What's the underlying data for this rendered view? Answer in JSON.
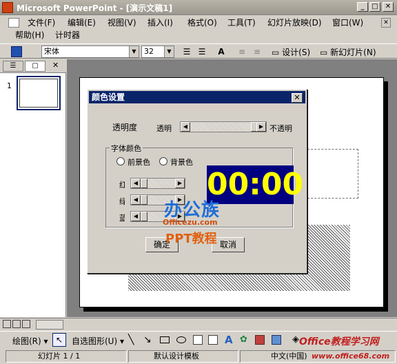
{
  "window": {
    "title": "Microsoft PowerPoint - [演示文稿1]"
  },
  "menu": {
    "items": [
      "文件(F)",
      "编辑(E)",
      "视图(V)",
      "插入(I)",
      "格式(O)",
      "工具(T)",
      "幻灯片放映(D)",
      "窗口(W)"
    ],
    "items_row2": [
      "帮助(H)",
      "计时器"
    ]
  },
  "toolbar": {
    "font": "宋体",
    "size": "32",
    "design_label": "设计(S)",
    "new_slide_label": "新幻灯片(N)"
  },
  "slides_pane": {
    "slide_number": "1"
  },
  "dialog": {
    "title": "颜色设置",
    "transparency_label": "透明度",
    "transparent": "透明",
    "opaque": "不透明",
    "font_color_group": "字体颜色",
    "foreground": "前景色",
    "background": "背景色",
    "red_label": "红",
    "green_label": "绿",
    "blue_label": "蓝",
    "clock": "00:00",
    "ok": "确定",
    "cancel": "取消"
  },
  "watermark": {
    "brand": "办公族",
    "site": "Officezu.com",
    "tag": "PPT教程"
  },
  "drawbar": {
    "draw": "绘图(R)",
    "autoshape": "自选图形(U)"
  },
  "corner_watermark": {
    "text1": "Office教程学习网",
    "text2": "www.office68.com"
  },
  "status": {
    "slide": "幻灯片 1 / 1",
    "design": "默认设计模板",
    "lang": "中文(中国)"
  },
  "colors": {
    "clock_bg": "#000080",
    "clock_fg": "#ffff00",
    "title_bg": "#0a246a"
  }
}
